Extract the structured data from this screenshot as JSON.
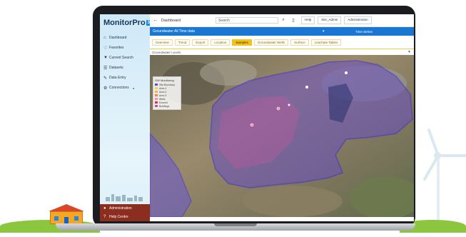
{
  "app": {
    "logo_text": "MonitorPro",
    "logo_tag": "360"
  },
  "sidebar": {
    "items": [
      {
        "label": "Dashboard",
        "icon": "home-icon"
      },
      {
        "label": "Favorites",
        "icon": "heart-icon"
      },
      {
        "label": "Current Search",
        "icon": "filter-icon"
      },
      {
        "label": "Datasets",
        "icon": "list-icon"
      },
      {
        "label": "Data Entry",
        "icon": "edit-icon"
      },
      {
        "label": "Connections",
        "icon": "gear-icon"
      }
    ],
    "bottom": [
      {
        "label": "Administration",
        "icon": "user-icon"
      },
      {
        "label": "Help Centre",
        "icon": "help-icon"
      }
    ]
  },
  "topbar": {
    "title": "Dashboard",
    "search_value": "Search",
    "buttons": [
      "Help",
      "Site_Admin",
      "Administration"
    ]
  },
  "bluebar": {
    "selected": "Groundwater All Time data",
    "right_label": "Time Series"
  },
  "tabs": [
    {
      "label": "Overview",
      "active": false
    },
    {
      "label": "Trend",
      "active": false
    },
    {
      "label": "Export",
      "active": false
    },
    {
      "label": "Location",
      "active": false
    },
    {
      "label": "Samples",
      "active": true
    },
    {
      "label": "Groundwater Wells",
      "active": false
    },
    {
      "label": "Surface",
      "active": false
    },
    {
      "label": "Leachate Tables",
      "active": false
    }
  ],
  "crumbs": {
    "text": "Groundwater Levels"
  },
  "map": {
    "legend_title": "GW Monitoring",
    "legend": [
      {
        "label": "Site Boundary",
        "color": "#5b4fd6"
      },
      {
        "label": "Area 1",
        "color": "#f2d14a"
      },
      {
        "label": "Area 2",
        "color": "#e8b84a"
      },
      {
        "label": "Area 3",
        "color": "#d98f4a"
      },
      {
        "label": "Wells",
        "color": "#f58fb0"
      },
      {
        "label": "Exceed",
        "color": "#e0304a"
      },
      {
        "label": "Buildings",
        "color": "#c74cc0"
      }
    ]
  },
  "colors": {
    "accent": "#1976d2",
    "tab_active": "#f4c21b",
    "admin_bar": "#8b2d1f"
  }
}
